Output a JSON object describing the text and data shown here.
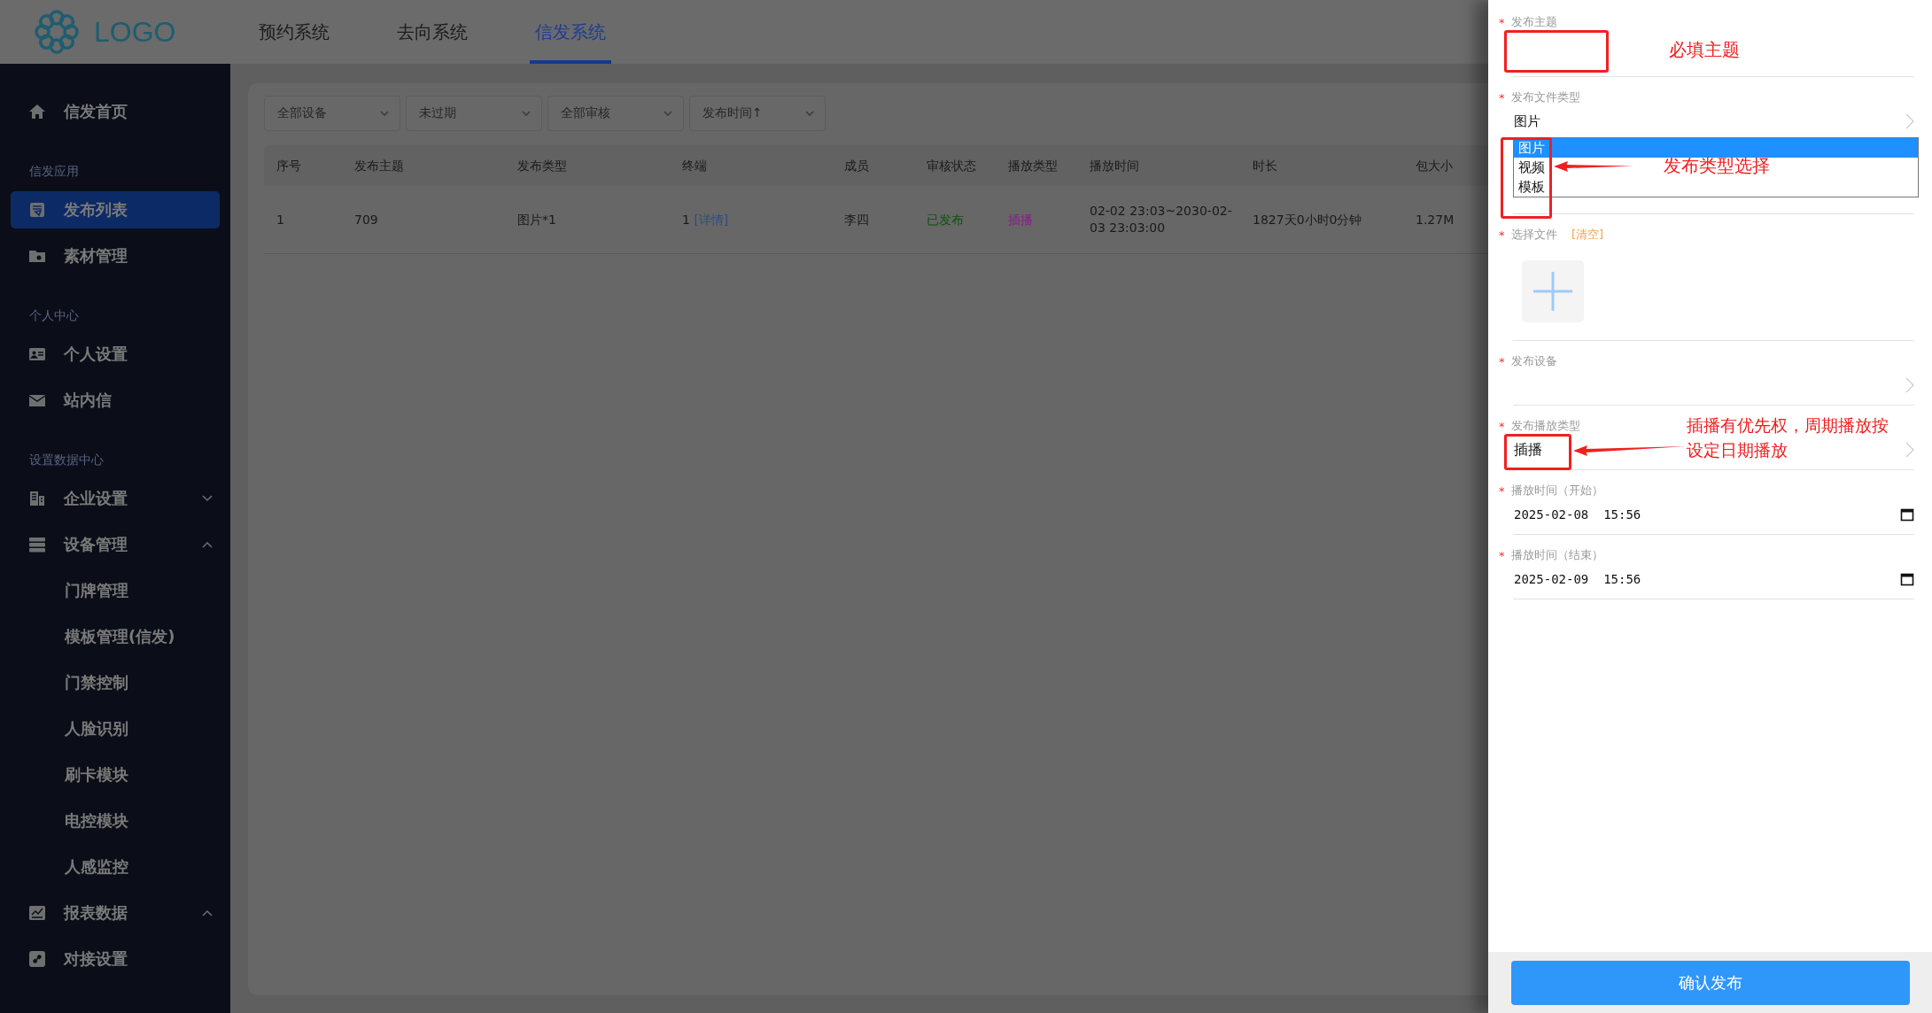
{
  "header": {
    "logo": "LOGO",
    "nav": [
      {
        "label": "预约系统",
        "selected": false
      },
      {
        "label": "去向系统",
        "selected": false
      },
      {
        "label": "信发系统",
        "selected": true
      }
    ]
  },
  "sidebar": {
    "items": [
      {
        "kind": "item",
        "label": "信发首页",
        "selected": false
      },
      {
        "kind": "section",
        "label": "信发应用"
      },
      {
        "kind": "item",
        "label": "发布列表",
        "selected": true
      },
      {
        "kind": "item",
        "label": "素材管理",
        "selected": false
      },
      {
        "kind": "section",
        "label": "个人中心"
      },
      {
        "kind": "item",
        "label": "个人设置",
        "selected": false
      },
      {
        "kind": "item",
        "label": "站内信",
        "selected": false
      },
      {
        "kind": "section",
        "label": "设置数据中心"
      },
      {
        "kind": "item",
        "label": "企业设置",
        "selected": false,
        "expanded": false
      },
      {
        "kind": "item",
        "label": "设备管理",
        "selected": false,
        "expanded": true,
        "children": [
          {
            "label": "门牌管理"
          },
          {
            "label": "模板管理(信发)"
          },
          {
            "label": "门禁控制"
          },
          {
            "label": "人脸识别"
          },
          {
            "label": "刷卡模块"
          },
          {
            "label": "电控模块"
          },
          {
            "label": "人感监控"
          }
        ]
      },
      {
        "kind": "item",
        "label": "报表数据",
        "selected": false,
        "expanded": true
      },
      {
        "kind": "item",
        "label": "对接设置",
        "selected": false
      }
    ]
  },
  "filters": [
    {
      "value": "全部设备"
    },
    {
      "value": "未过期"
    },
    {
      "value": "全部审核"
    },
    {
      "value": "发布时间↑"
    }
  ],
  "table": {
    "columns": [
      "序号",
      "发布主题",
      "发布类型",
      "终端",
      "成员",
      "审核状态",
      "播放类型",
      "播放时间",
      "时长",
      "包大小"
    ],
    "rows": [
      {
        "index": "1",
        "subject": "709",
        "type": "图片*1",
        "terminal": "1",
        "detail_link": "[详情]",
        "member": "李四",
        "status": {
          "text": "已发布",
          "color": "#0b520b"
        },
        "play_type": {
          "text": "插播",
          "color": "#8a1a8a"
        },
        "play_time": "02-02 23:03~2030-02-03 23:03:00",
        "duration": "1827天0小时0分钟",
        "size": "1.27M"
      }
    ]
  },
  "drawer": {
    "fields": [
      {
        "kind": "text",
        "label": "发布主题",
        "required_mark": "*",
        "note": "必填主题"
      },
      {
        "kind": "select",
        "label": "发布文件类型",
        "required_mark": "*",
        "value": "图片",
        "note": "发布类型选择",
        "options": [
          {
            "label": "图片",
            "selected": true
          },
          {
            "label": "视频",
            "selected": false
          },
          {
            "label": "模板",
            "selected": false
          }
        ]
      },
      {
        "kind": "upload",
        "label": "选择文件",
        "required_mark": "*",
        "action": "[清空]"
      },
      {
        "kind": "picker",
        "label": "发布设备",
        "required_mark": "*"
      },
      {
        "kind": "picker",
        "label": "发布播放类型",
        "required_mark": "*",
        "value": "插播",
        "note": "插播有优先权，周期播放按设定日期播放"
      },
      {
        "kind": "datetime",
        "label": "播放时间（开始）",
        "required_mark": "*",
        "value": "2025-02-08  15:56"
      },
      {
        "kind": "datetime",
        "label": "播放时间（结束）",
        "required_mark": "*",
        "value": "2025-02-09  15:56"
      }
    ],
    "submit": "确认发布"
  }
}
